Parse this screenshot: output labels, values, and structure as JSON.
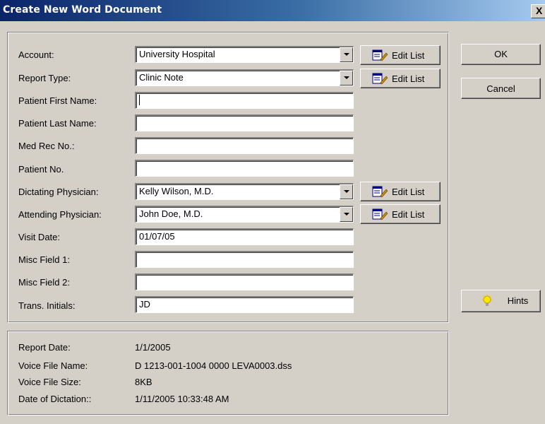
{
  "window": {
    "title": "Create New Word Document",
    "close_glyph": "X"
  },
  "form": {
    "account": {
      "label": "Account:",
      "value": "University Hospital",
      "edit_label": "Edit List"
    },
    "report_type": {
      "label": "Report Type:",
      "value": "Clinic Note",
      "edit_label": "Edit List"
    },
    "patient_first_name": {
      "label": "Patient First Name:",
      "value": ""
    },
    "patient_last_name": {
      "label": "Patient Last Name:",
      "value": ""
    },
    "med_rec_no": {
      "label": "Med Rec No.:",
      "value": ""
    },
    "patient_no": {
      "label": "Patient No.",
      "value": ""
    },
    "dictating_physician": {
      "label": "Dictating Physician:",
      "value": "Kelly Wilson, M.D.",
      "edit_label": "Edit List"
    },
    "attending_physician": {
      "label": "Attending Physician:",
      "value": "John Doe, M.D.",
      "edit_label": "Edit List"
    },
    "visit_date": {
      "label": "Visit Date:",
      "value": "01/07/05"
    },
    "misc_field_1": {
      "label": "Misc Field 1:",
      "value": ""
    },
    "misc_field_2": {
      "label": "Misc Field 2:",
      "value": ""
    },
    "trans_initials": {
      "label": "Trans. Initials:",
      "value": "JD"
    }
  },
  "buttons": {
    "ok": "OK",
    "cancel": "Cancel",
    "hints": "Hints"
  },
  "info": {
    "report_date": {
      "label": "Report Date:",
      "value": "1/1/2005"
    },
    "voice_file_name": {
      "label": "Voice File Name:",
      "value": "D 1213-001-1004 0000 LEVA0003.dss"
    },
    "voice_file_size": {
      "label": "Voice File Size:",
      "value": "8KB"
    },
    "date_of_dictation": {
      "label": "Date of Dictation::",
      "value": "1/11/2005 10:33:48 AM"
    }
  },
  "icons": {
    "edit_list": "notepad-pencil-icon",
    "dropdown": "chevron-down-icon",
    "hints": "lightbulb-icon"
  }
}
